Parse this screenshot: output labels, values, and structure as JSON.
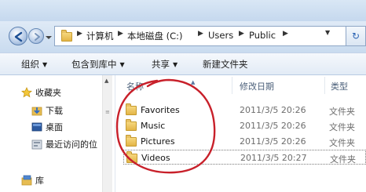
{
  "address": {
    "crumbs": [
      "计算机",
      "本地磁盘 (C:)",
      "Users",
      "Public"
    ]
  },
  "toolbar": {
    "organize": "组织",
    "include_library": "包含到库中",
    "share": "共享",
    "new_folder": "新建文件夹"
  },
  "nav": {
    "favorites": "收藏夹",
    "downloads": "下载",
    "desktop": "桌面",
    "recent": "最近访问的位",
    "libraries": "库"
  },
  "columns": {
    "name": "名称",
    "date": "修改日期",
    "type": "类型"
  },
  "files": [
    {
      "name": "Favorites",
      "date": "2011/3/5 20:26",
      "type": "文件夹"
    },
    {
      "name": "Music",
      "date": "2011/3/5 20:26",
      "type": "文件夹"
    },
    {
      "name": "Pictures",
      "date": "2011/3/5 20:26",
      "type": "文件夹"
    },
    {
      "name": "Videos",
      "date": "2011/3/5 20:27",
      "type": "文件夹"
    }
  ],
  "colors": {
    "annotation_circle": "#c8202a",
    "folder": "#e3b547",
    "header_text": "#4c607a"
  }
}
